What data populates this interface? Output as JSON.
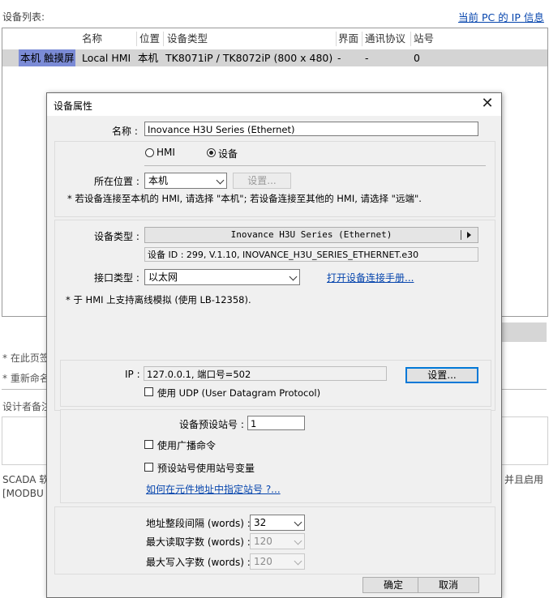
{
  "background": {
    "device_list_label": "设备列表:",
    "pc_ip_link": "当前 PC 的 IP 信息",
    "columns": [
      "名称",
      "位置",
      "设备类型",
      "界面",
      "通讯协议",
      "站号"
    ],
    "row": {
      "selected_name": "本机 触摸屏",
      "name": "Local HMI",
      "location": "本机",
      "device_type": "TK8071iP / TK8072iP (800 x 480)",
      "interface": "-",
      "protocol": "-",
      "station": "0"
    },
    "note1": "* 在此页签",
    "note2": "* 重新命名",
    "designer_label": "设计者备注",
    "scada_text": "SCADA 软",
    "modbus_text": "[MODBU",
    "right_text": "并且启用"
  },
  "dialog": {
    "title": "设备属性",
    "name_label": "名称 :",
    "name_value": "Inovance H3U Series (Ethernet)",
    "radio_hmi": "HMI",
    "radio_device": "设备",
    "location_label": "所在位置 :",
    "location_value": "本机",
    "location_settings_btn": "设置...",
    "location_note": "* 若设备连接至本机的 HMI, 请选择 \"本机\"; 若设备连接至其他的 HMI, 请选择 \"远端\".",
    "device_type_label": "设备类型 :",
    "device_type_value": "Inovance H3U Series (Ethernet)",
    "device_id": "设备 ID : 299, V.1.10, INOVANCE_H3U_SERIES_ETHERNET.e30",
    "interface_label": "接口类型 :",
    "interface_value": "以太网",
    "open_manual_link": "打开设备连接手册...",
    "offline_note": "* 于 HMI 上支持离线模拟 (使用 LB-12358).",
    "ip_label": "IP :",
    "ip_value": "127.0.0.1, 端口号=502",
    "ip_settings_btn": "设置...",
    "udp_label": "使用 UDP (User Datagram Protocol)",
    "default_station_label": "设备预设站号 :",
    "default_station_value": "1",
    "broadcast_label": "使用广播命令",
    "station_var_label": "预设站号使用站号变量",
    "station_link": "如何在元件地址中指定站号 ?...",
    "addr_interval_label": "地址整段间隔 (words) :",
    "addr_interval_value": "32",
    "max_read_label": "最大读取字数 (words) :",
    "max_read_value": "120",
    "max_write_label": "最大写入字数 (words) :",
    "max_write_value": "120",
    "ok_btn": "确定",
    "cancel_btn": "取消",
    "close_glyph": "✕"
  }
}
